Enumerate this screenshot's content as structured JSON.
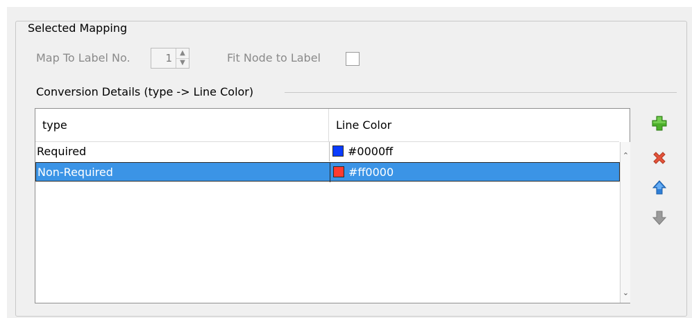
{
  "fieldset": {
    "title": "Selected Mapping"
  },
  "map_to_label": {
    "label": "Map To Label No.",
    "value": "1"
  },
  "fit_node": {
    "label": "Fit Node to Label",
    "checked": false
  },
  "conversion": {
    "title": "Conversion Details (type -> Line Color)"
  },
  "table": {
    "columns": [
      "type",
      "Line Color"
    ],
    "rows": [
      {
        "type": "Required",
        "color_text": "#0000ff",
        "swatch": "#0a3cff",
        "selected": false
      },
      {
        "type": "Non-Required",
        "color_text": "#ff0000",
        "swatch": "#ff3b30",
        "selected": true
      }
    ]
  },
  "actions": {
    "add_icon": "plus-icon",
    "delete_icon": "x-icon",
    "up_icon": "arrow-up-icon",
    "down_icon": "arrow-down-icon"
  },
  "colors": {
    "selection": "#3b94e6",
    "add": "#4caf2a",
    "delete": "#e5533b",
    "up": "#2e7ed6",
    "down": "#9a9a9a"
  }
}
